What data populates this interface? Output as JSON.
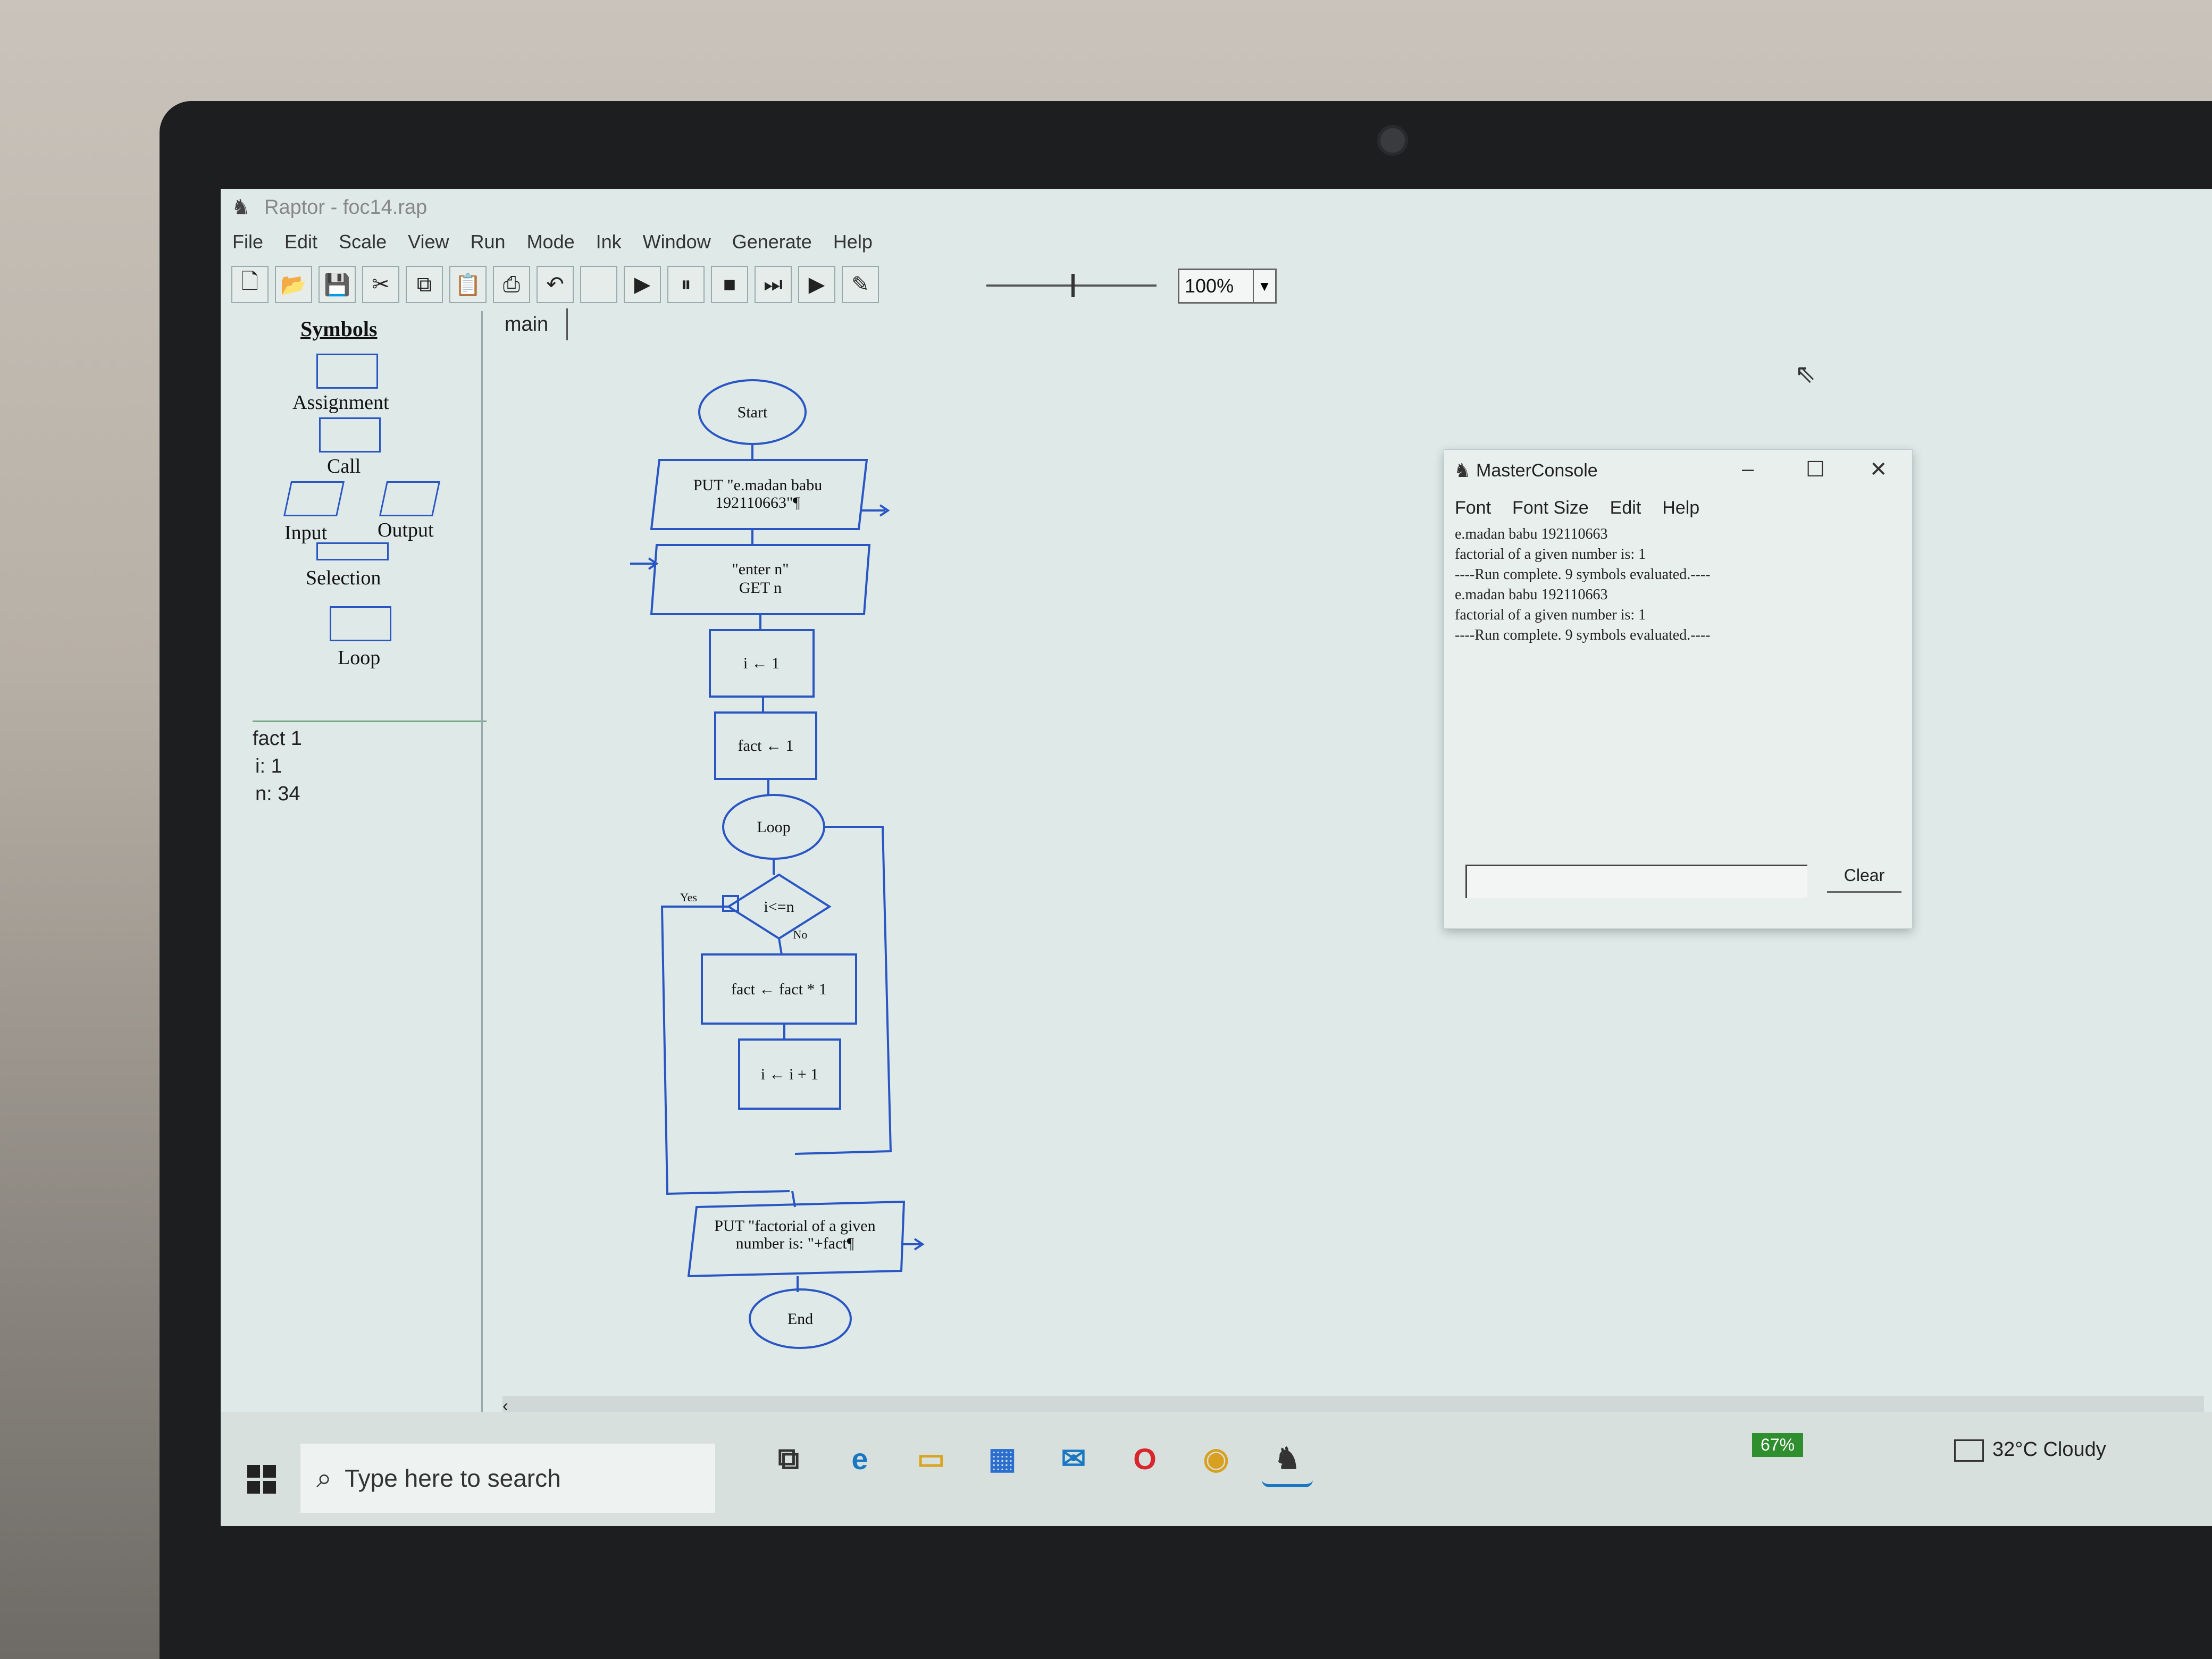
{
  "window": {
    "title": "Raptor - foc14.rap"
  },
  "menu": [
    "File",
    "Edit",
    "Scale",
    "View",
    "Run",
    "Mode",
    "Ink",
    "Window",
    "Generate",
    "Help"
  ],
  "toolbar": {
    "icons": [
      "new-icon",
      "open-icon",
      "save-icon",
      "cut-icon",
      "copy-icon",
      "paste-icon",
      "print-icon",
      "undo-icon",
      "redo-icon",
      "run-icon",
      "pause-icon",
      "stop-icon",
      "step-icon",
      "run-compiled-icon",
      "pen-icon"
    ],
    "zoom": "100%"
  },
  "symbols": {
    "header": "Symbols",
    "items": [
      "Assignment",
      "Call",
      "Input",
      "Output",
      "Selection",
      "Loop"
    ]
  },
  "variables": [
    "fact 1",
    "i: 1",
    "n: 34"
  ],
  "tab": "main",
  "flowchart": {
    "start": "Start",
    "output1_line1": "PUT \"e.madan babu",
    "output1_line2": "192110663\"¶",
    "input_line1": "\"enter n\"",
    "input_line2": "GET n",
    "assign_i": "i ← 1",
    "assign_fact": "fact ← 1",
    "loop": "Loop",
    "cond": "i<=n",
    "yes": "Yes",
    "no": "No",
    "assign_fact2": "fact ← fact * 1",
    "assign_i2": "i ← i + 1",
    "output2_line1": "PUT \"factorial of a given",
    "output2_line2": "number is: \"+fact¶",
    "end": "End"
  },
  "console": {
    "title": "MasterConsole",
    "menu": [
      "Font",
      "Font Size",
      "Edit",
      "Help"
    ],
    "lines": [
      "e.madan babu 192110663",
      "factorial of a given number is: 1",
      "----Run complete.  9 symbols evaluated.----",
      "e.madan babu 192110663",
      "factorial of a given number is: 1",
      "----Run complete.  9 symbols evaluated.----"
    ],
    "clear": "Clear"
  },
  "taskbar": {
    "search_placeholder": "Type here to search",
    "battery": "67%",
    "weather": "32°C  Cloudy"
  },
  "colors": {
    "flow_line": "#2a56c4",
    "screen_bg": "#dfeae8"
  }
}
